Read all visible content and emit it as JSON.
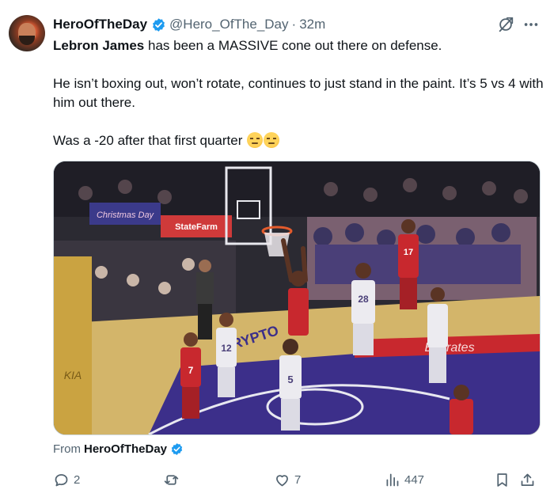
{
  "author": {
    "display_name": "HeroOfTheDay",
    "handle": "@Hero_OfThe_Day",
    "separator": "·",
    "time": "32m"
  },
  "tweet": {
    "mention": "Lebron James",
    "line1_rest": " has been a MASSIVE cone out there on defense.",
    "line2": "He isn’t boxing out, won’t rotate, continues to just stand in the paint. It’s 5 vs 4 with him out there.",
    "line3": "Was a -20 after that first quarter",
    "emojis": [
      "unamused-face",
      "unamused-face"
    ]
  },
  "media": {
    "banners": [
      "Christmas Day",
      "StateFarm",
      "Emirates",
      "KIA",
      "CRYPTO"
    ],
    "jerseys": [
      "17",
      "28",
      "12",
      "5",
      "7"
    ]
  },
  "source": {
    "prefix": "From",
    "name": "HeroOfTheDay"
  },
  "actions": {
    "reply_count": "2",
    "repost_count": "",
    "like_count": "7",
    "view_count": "447"
  },
  "colors": {
    "verified": "#1d9bf0",
    "text": "#0f1419",
    "secondary": "#536471",
    "court_floor": "#d3b56a",
    "paint_purple": "#3c2f8a",
    "rockets_red": "#c8282e"
  }
}
